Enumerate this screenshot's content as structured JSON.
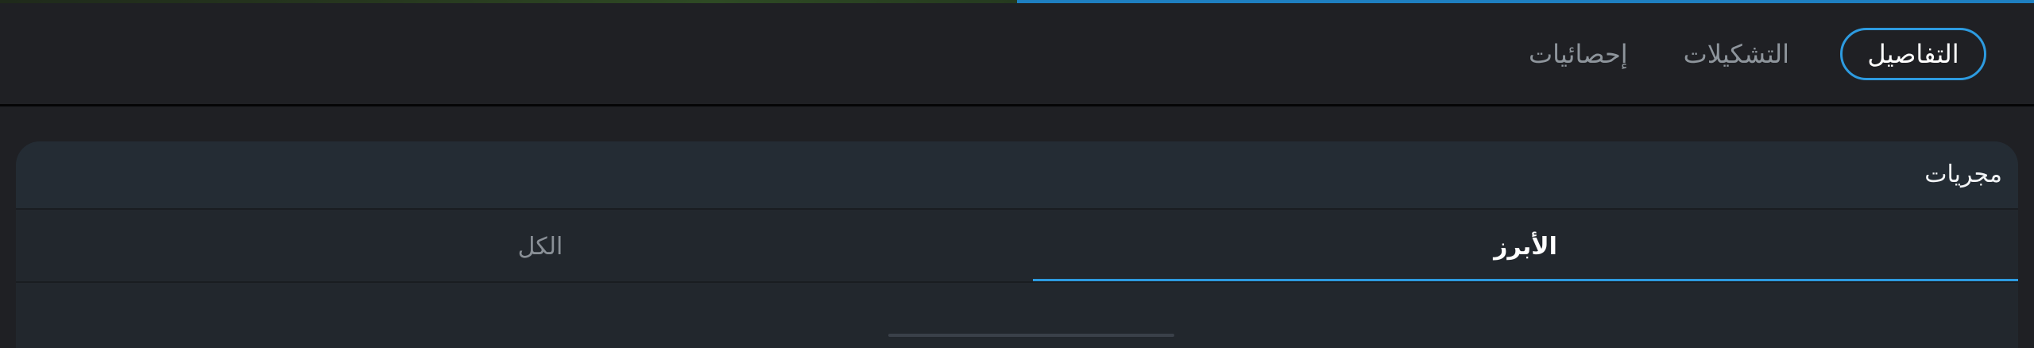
{
  "tabs": [
    {
      "label": "التفاصيل",
      "active": true
    },
    {
      "label": "التشكيلات",
      "active": false
    },
    {
      "label": "إحصائيات",
      "active": false
    }
  ],
  "card": {
    "title": "مجريات",
    "subtabs": [
      {
        "label": "الأبرز",
        "active": true
      },
      {
        "label": "الكل",
        "active": false
      }
    ]
  },
  "colors": {
    "accent": "#2d9be0",
    "background": "#1f2024",
    "card": "#22272d"
  }
}
